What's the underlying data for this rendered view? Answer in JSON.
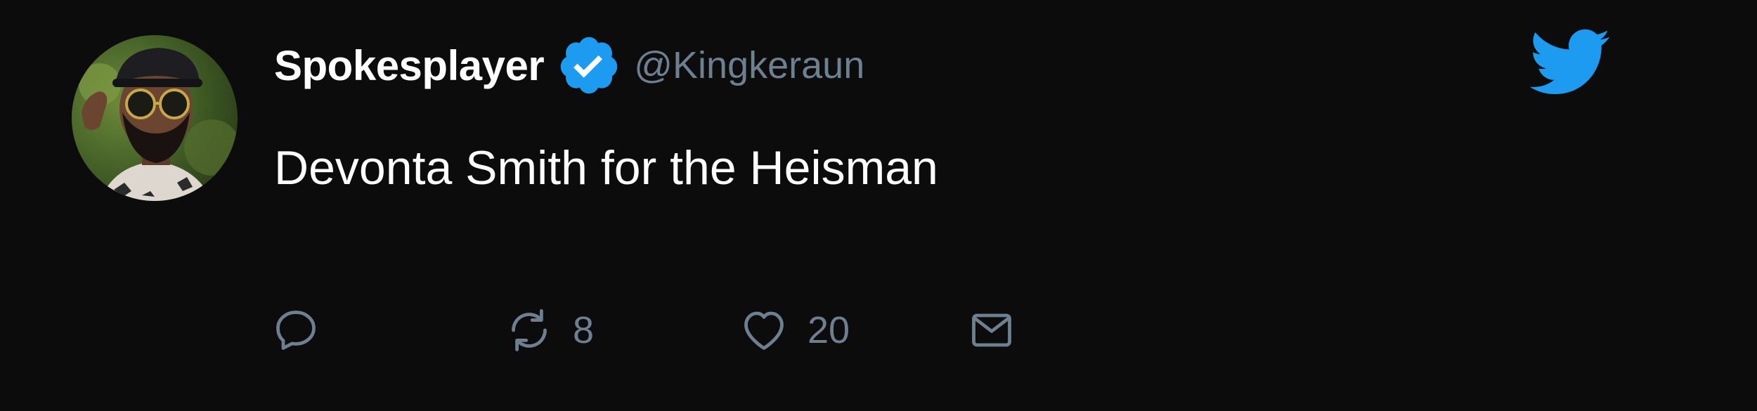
{
  "tweet": {
    "display_name": "Spokesplayer",
    "handle": "@Kingkeraun",
    "text": "Devonta Smith for the Heisman",
    "verified": true,
    "avatar_icon": "avatar-photo",
    "platform_icon": "twitter-bird-icon",
    "colors": {
      "background": "#0c0c0d",
      "text": "#ffffff",
      "muted": "#6e7f8f",
      "accent": "#1d9bf0"
    },
    "actions": {
      "reply": {
        "icon": "reply-icon",
        "count": ""
      },
      "retweet": {
        "icon": "retweet-icon",
        "count": "8"
      },
      "like": {
        "icon": "heart-icon",
        "count": "20"
      },
      "share": {
        "icon": "mail-icon",
        "count": ""
      }
    }
  }
}
